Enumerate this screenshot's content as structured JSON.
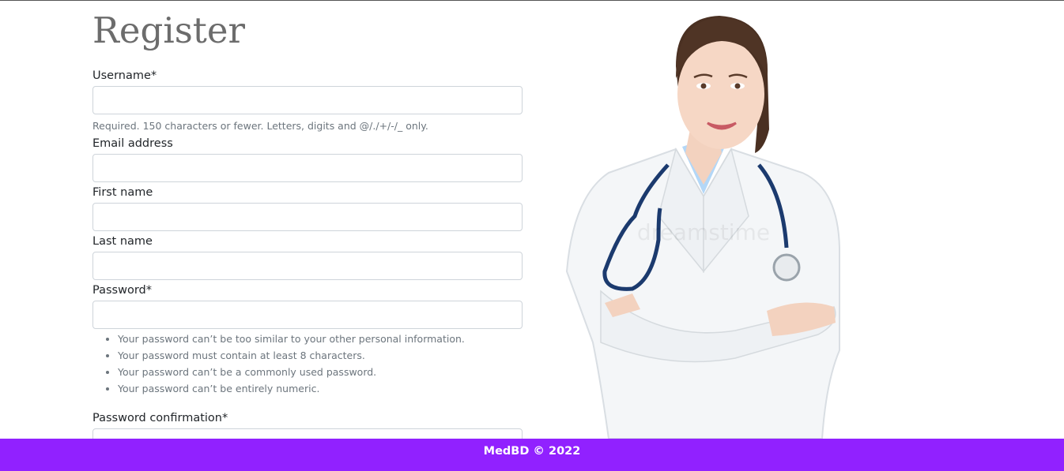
{
  "form": {
    "title": "Register",
    "username": {
      "label": "Username*",
      "value": "",
      "help": "Required. 150 characters or fewer. Letters, digits and @/./+/-/_ only."
    },
    "email": {
      "label": "Email address",
      "value": ""
    },
    "first_name": {
      "label": "First name",
      "value": ""
    },
    "last_name": {
      "label": "Last name",
      "value": ""
    },
    "password": {
      "label": "Password*",
      "value": "",
      "rules": [
        "Your password can’t be too similar to your other personal information.",
        "Your password must contain at least 8 characters.",
        "Your password can’t be a commonly used password.",
        "Your password can’t be entirely numeric."
      ]
    },
    "password_confirmation": {
      "label": "Password confirmation*",
      "value": ""
    }
  },
  "hero_image": {
    "watermark": "dreamstime"
  },
  "footer": {
    "text": "MedBD © 2022",
    "bg_color": "#9121ff"
  }
}
